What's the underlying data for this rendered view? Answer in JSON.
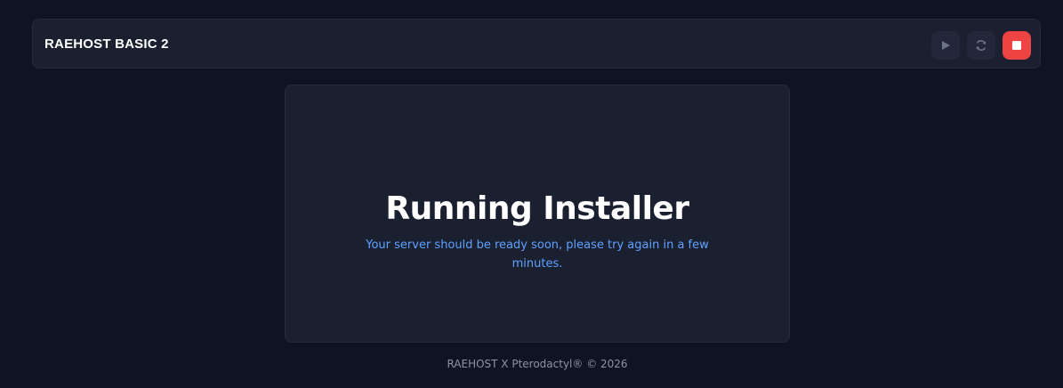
{
  "header": {
    "server_name": "RAEHOST BASIC 2",
    "controls": {
      "start_icon": "play-icon",
      "restart_icon": "refresh-icon",
      "stop_icon": "stop-icon"
    }
  },
  "main": {
    "title": "Running Installer",
    "message": "Your server should be ready soon, please try again in a few minutes."
  },
  "footer": {
    "text": "RAEHOST X Pterodactyl® © 2026"
  },
  "colors": {
    "background": "#0f1423",
    "panel": "#1b2030",
    "accent_text": "#5ea1ff",
    "stop_button": "#ef4444"
  }
}
